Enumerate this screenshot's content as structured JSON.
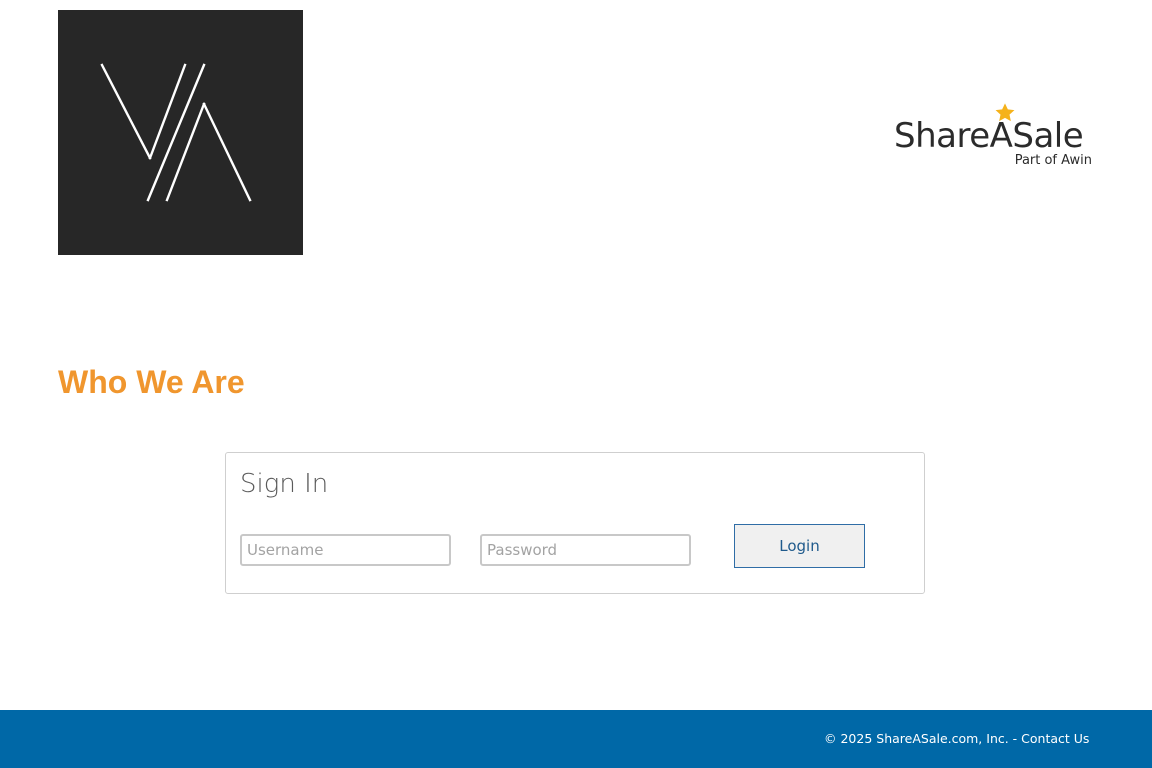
{
  "merchant_logo": {
    "text": "VA",
    "background": "#272727"
  },
  "sas_logo": {
    "wordmark": "ShareASale",
    "subtitle": "Part of Awin",
    "star_color": "#f5b21b"
  },
  "heading": "Who We Are",
  "signin": {
    "title": "Sign In",
    "username_placeholder": "Username",
    "password_placeholder": "Password",
    "login_label": "Login"
  },
  "footer": {
    "copyright": "© 2025 ShareASale.com, Inc. - ",
    "contact_label": "Contact Us",
    "background": "#0068a7"
  },
  "colors": {
    "accent": "#f0962e",
    "button_border": "#2f6da6"
  }
}
